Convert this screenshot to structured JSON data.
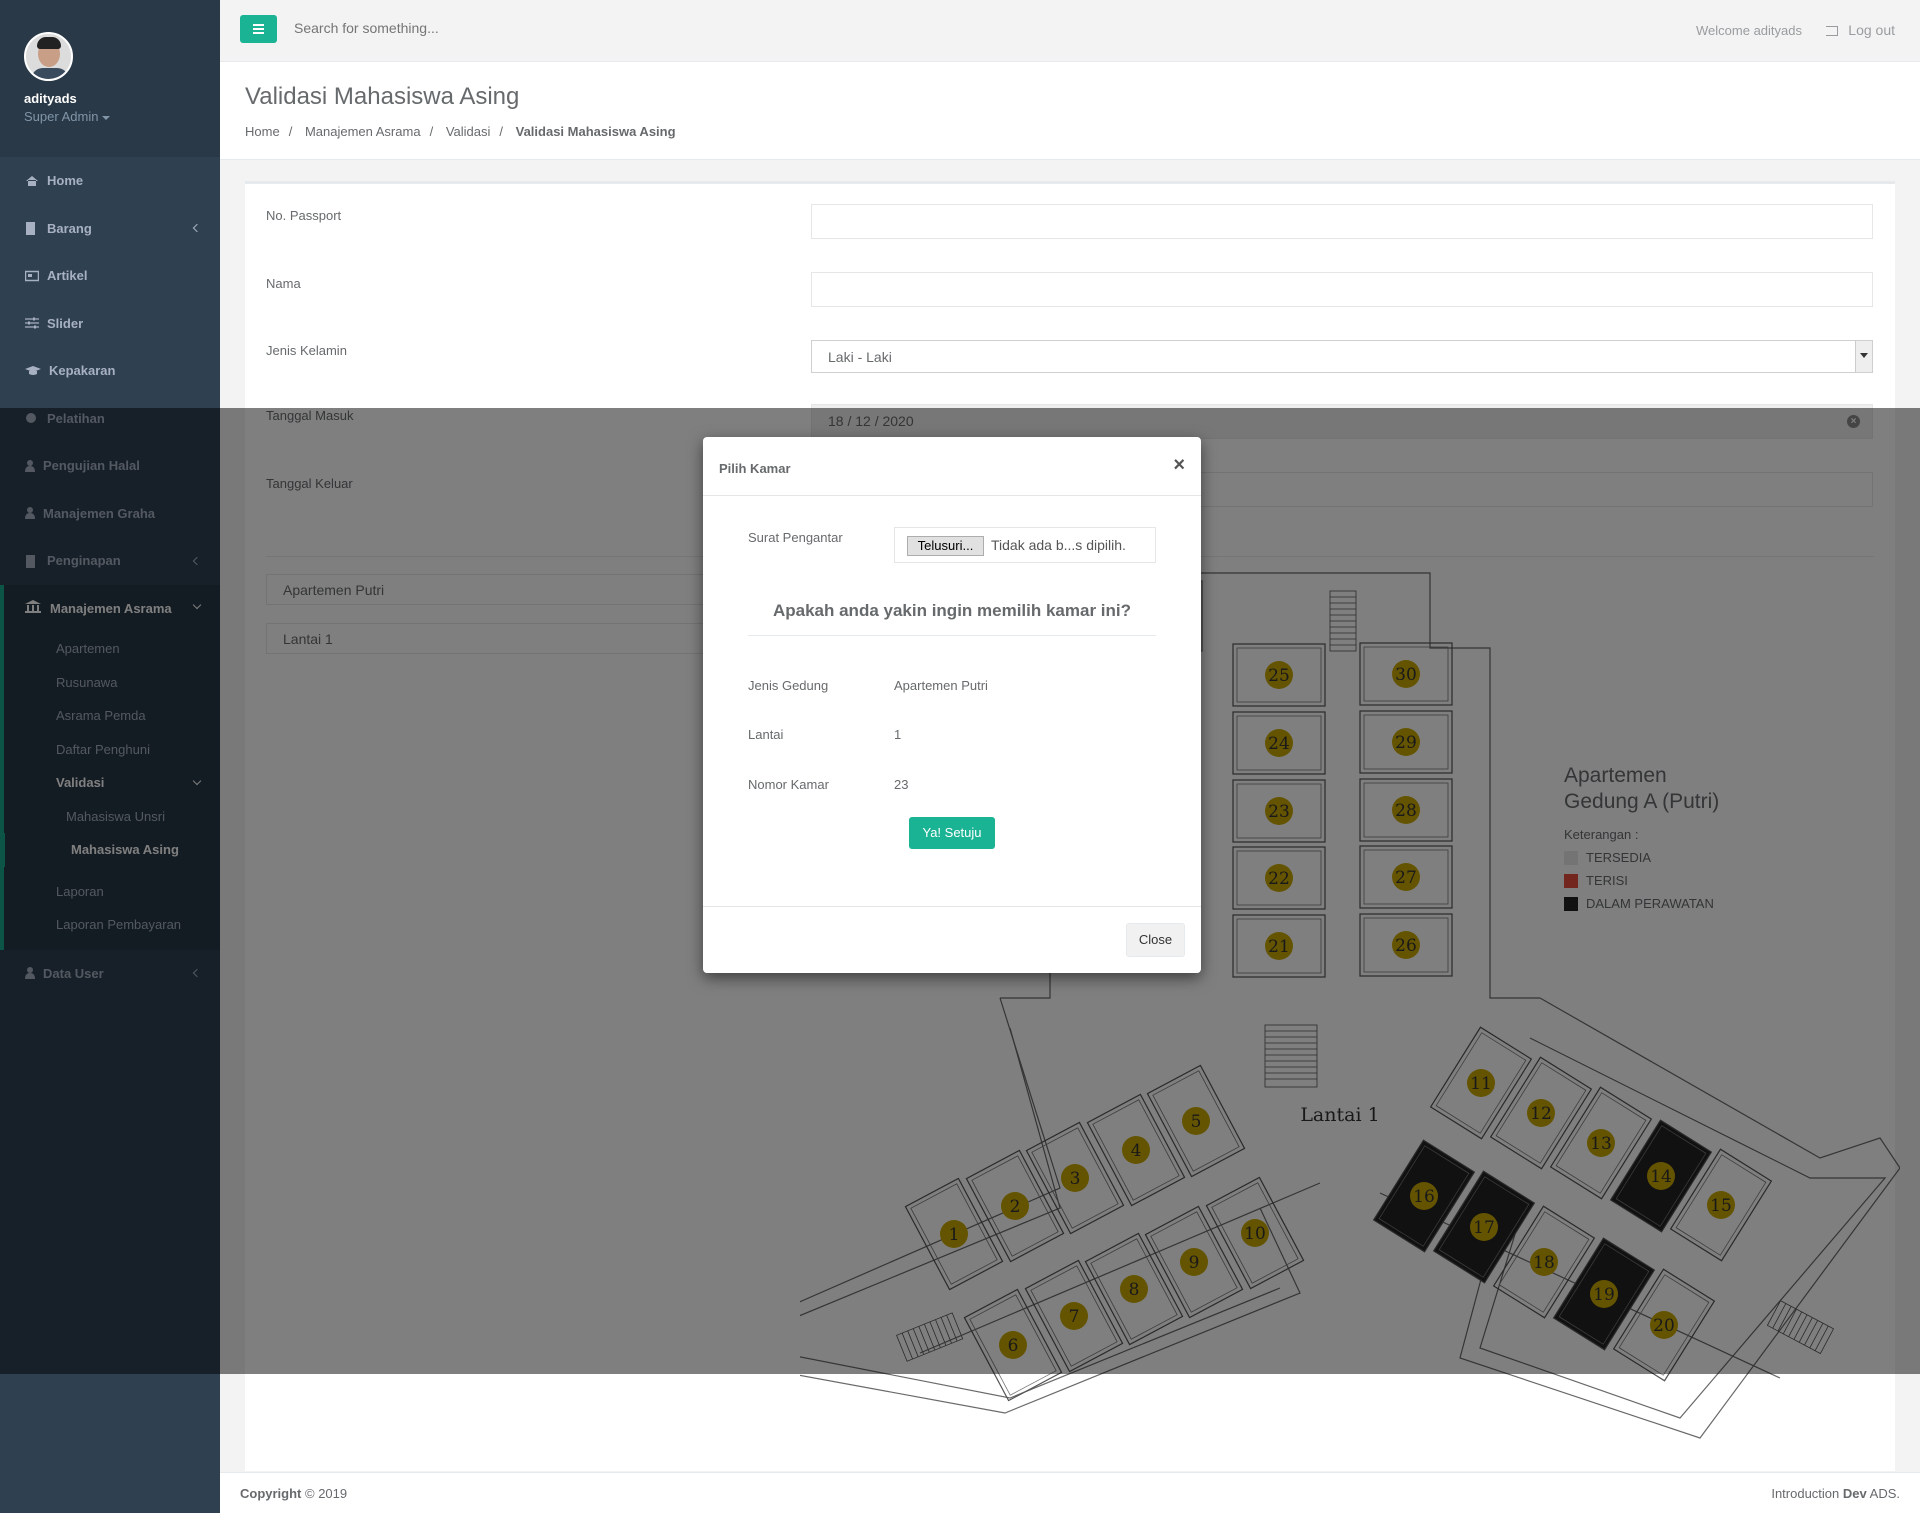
{
  "sidebar": {
    "user": {
      "name": "adityads",
      "role": "Super Admin"
    },
    "items": [
      {
        "label": "Home",
        "icon": "home-icon"
      },
      {
        "label": "Barang",
        "icon": "book-icon"
      },
      {
        "label": "Artikel",
        "icon": "newspaper-icon"
      },
      {
        "label": "Slider",
        "icon": "sliders-icon"
      },
      {
        "label": "Kepakaran",
        "icon": "graduation-cap-icon"
      },
      {
        "label": "Pelatihan",
        "icon": "circle-icon"
      },
      {
        "label": "Pengujian Halal",
        "icon": "user-icon"
      },
      {
        "label": "Manajemen Graha",
        "icon": "user-icon"
      },
      {
        "label": "Penginapan",
        "icon": "book-icon"
      }
    ],
    "active_group": {
      "label": "Manajemen Asrama",
      "icon": "bank-icon",
      "subitems": [
        "Apartemen",
        "Rusunawa",
        "Asrama Pemda",
        "Daftar Penghuni"
      ],
      "validasi": {
        "label": "Validasi",
        "children": [
          "Mahasiswa Unsri",
          "Mahasiswa Asing"
        ]
      },
      "after": [
        "Laporan",
        "Laporan Pembayaran"
      ]
    },
    "data_user": {
      "label": "Data User",
      "icon": "user-icon"
    }
  },
  "topbar": {
    "search_placeholder": "Search for something...",
    "welcome": "Welcome adityads",
    "logout": "Log out"
  },
  "heading": {
    "title": "Validasi Mahasiswa Asing",
    "breadcrumb": [
      "Home",
      "Manajemen Asrama",
      "Validasi",
      "Validasi Mahasiswa Asing"
    ]
  },
  "form": {
    "passport_label": "No. Passport",
    "passport_value": "",
    "nama_label": "Nama",
    "nama_value": "",
    "gender_label": "Jenis Kelamin",
    "gender_value": "Laki - Laki",
    "masuk_label": "Tanggal Masuk",
    "masuk_value": "18 / 12 / 2020",
    "keluar_label": "Tanggal Keluar",
    "keluar_value": "",
    "gedung_value": "Apartemen Putri",
    "lantai_value": "Lantai 1"
  },
  "floorplan": {
    "floor_label": "Lantai 1",
    "available_color": "#c9a800",
    "occupied_color": "#222222",
    "rooms_occupied": [
      14,
      16,
      17,
      19
    ]
  },
  "legend": {
    "title_line1": "Apartemen",
    "title_line2": "Gedung A (Putri)",
    "keterangan": "Keterangan :",
    "items": [
      {
        "label": "TERSEDIA",
        "color": "#e8e8e8"
      },
      {
        "label": "TERISI",
        "color": "#e74c3c"
      },
      {
        "label": "DALAM PERAWATAN",
        "color": "#222222"
      }
    ]
  },
  "modal": {
    "title": "Pilih Kamar",
    "close_x": "×",
    "surat_label": "Surat Pengantar",
    "file_button": "Telusuri...",
    "file_text": "Tidak ada b...s dipilih.",
    "question": "Apakah anda yakin ingin memilih kamar ini?",
    "jenis_label": "Jenis Gedung",
    "jenis_value": "Apartemen Putri",
    "lantai_label": "Lantai",
    "lantai_value": "1",
    "nomor_label": "Nomor Kamar",
    "nomor_value": "23",
    "confirm": "Ya! Setuju",
    "close": "Close"
  },
  "footer": {
    "copyright_bold": "Copyright",
    "copyright_rest": "© 2019",
    "right_pre": "Introduction",
    "right_bold": "Dev",
    "right_post": "ADS."
  }
}
